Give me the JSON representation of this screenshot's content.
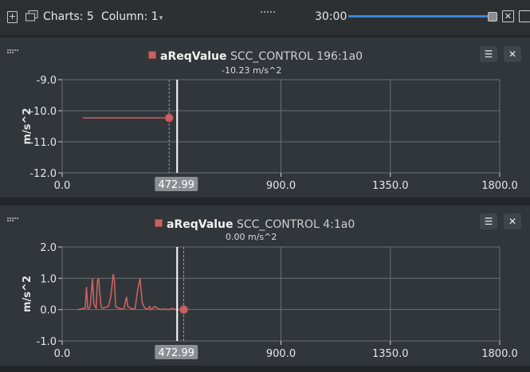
{
  "toolbar": {
    "charts_label": "Charts: 5",
    "column_label": "Column: 1",
    "time_label": "30:00",
    "zoom_fraction": 0.97
  },
  "colors": {
    "background": "#31363b",
    "grid": "#6a6f74",
    "series": "#c9625f",
    "cursor": "#ffffff",
    "accent": "#3b86d6"
  },
  "charts": [
    {
      "signal_name": "aReqValue",
      "signal_source": "SCC_CONTROL 196:1a0",
      "value_label": "-10.23 m/s^2",
      "cursor_label": "472.99",
      "menu_icon": "menu-icon",
      "close_icon": "close-icon"
    },
    {
      "signal_name": "aReqValue",
      "signal_source": "SCC_CONTROL 4:1a0",
      "value_label": "0.00 m/s^2",
      "cursor_label": "472.99",
      "menu_icon": "menu-icon",
      "close_icon": "close-icon"
    }
  ],
  "chart_data": [
    {
      "type": "line",
      "ylabel": "m/s^2",
      "xlim": [
        0,
        1800
      ],
      "ylim": [
        -12,
        -9
      ],
      "x_ticks": [
        "0.0",
        "900.0",
        "1350.0",
        "1800.0"
      ],
      "y_ticks": [
        "-9.0",
        "-10.0",
        "-11.0",
        "-12.0"
      ],
      "cursor_x": 472.99,
      "hover_x": 440,
      "series": [
        {
          "x": [
            85,
            440
          ],
          "y": [
            -10.23,
            -10.23
          ]
        }
      ],
      "marker": {
        "x": 440,
        "y": -10.23
      }
    },
    {
      "type": "line",
      "ylabel": "m/s^2",
      "xlim": [
        0,
        1800
      ],
      "ylim": [
        -1,
        2
      ],
      "x_ticks": [
        "0.0",
        "900.0",
        "1350.0",
        "1800.0"
      ],
      "y_ticks": [
        "2.0",
        "1.0",
        "0.0",
        "-1.0"
      ],
      "cursor_x": 472.99,
      "hover_x": 500,
      "series": [
        {
          "x": [
            65,
            95,
            100,
            105,
            110,
            115,
            125,
            130,
            135,
            140,
            145,
            150,
            155,
            160,
            165,
            170,
            180,
            190,
            200,
            210,
            215,
            220,
            230,
            240,
            250,
            255,
            260,
            265,
            270,
            280,
            290,
            300,
            310,
            320,
            330,
            340,
            350,
            355,
            360,
            365,
            370,
            380,
            390,
            400,
            410,
            420,
            440,
            450,
            470,
            490,
            510,
            520
          ],
          "y": [
            0.0,
            0.05,
            0.72,
            0.05,
            0.03,
            0.1,
            0.98,
            0.2,
            0.1,
            0.05,
            0.9,
            1.0,
            0.5,
            0.1,
            0.04,
            0.05,
            0.08,
            0.1,
            0.4,
            1.13,
            0.9,
            0.1,
            0.05,
            0.03,
            0.02,
            0.05,
            0.25,
            0.4,
            0.1,
            0.05,
            0.02,
            0.03,
            0.6,
            1.0,
            0.2,
            0.05,
            0.02,
            0.03,
            0.1,
            0.0,
            0.02,
            0.1,
            0.05,
            0.02,
            0.0,
            0.02,
            0.0,
            0.04,
            0.0,
            0.0,
            0.0,
            0.0
          ]
        }
      ],
      "marker": {
        "x": 500,
        "y": 0.0
      }
    }
  ]
}
